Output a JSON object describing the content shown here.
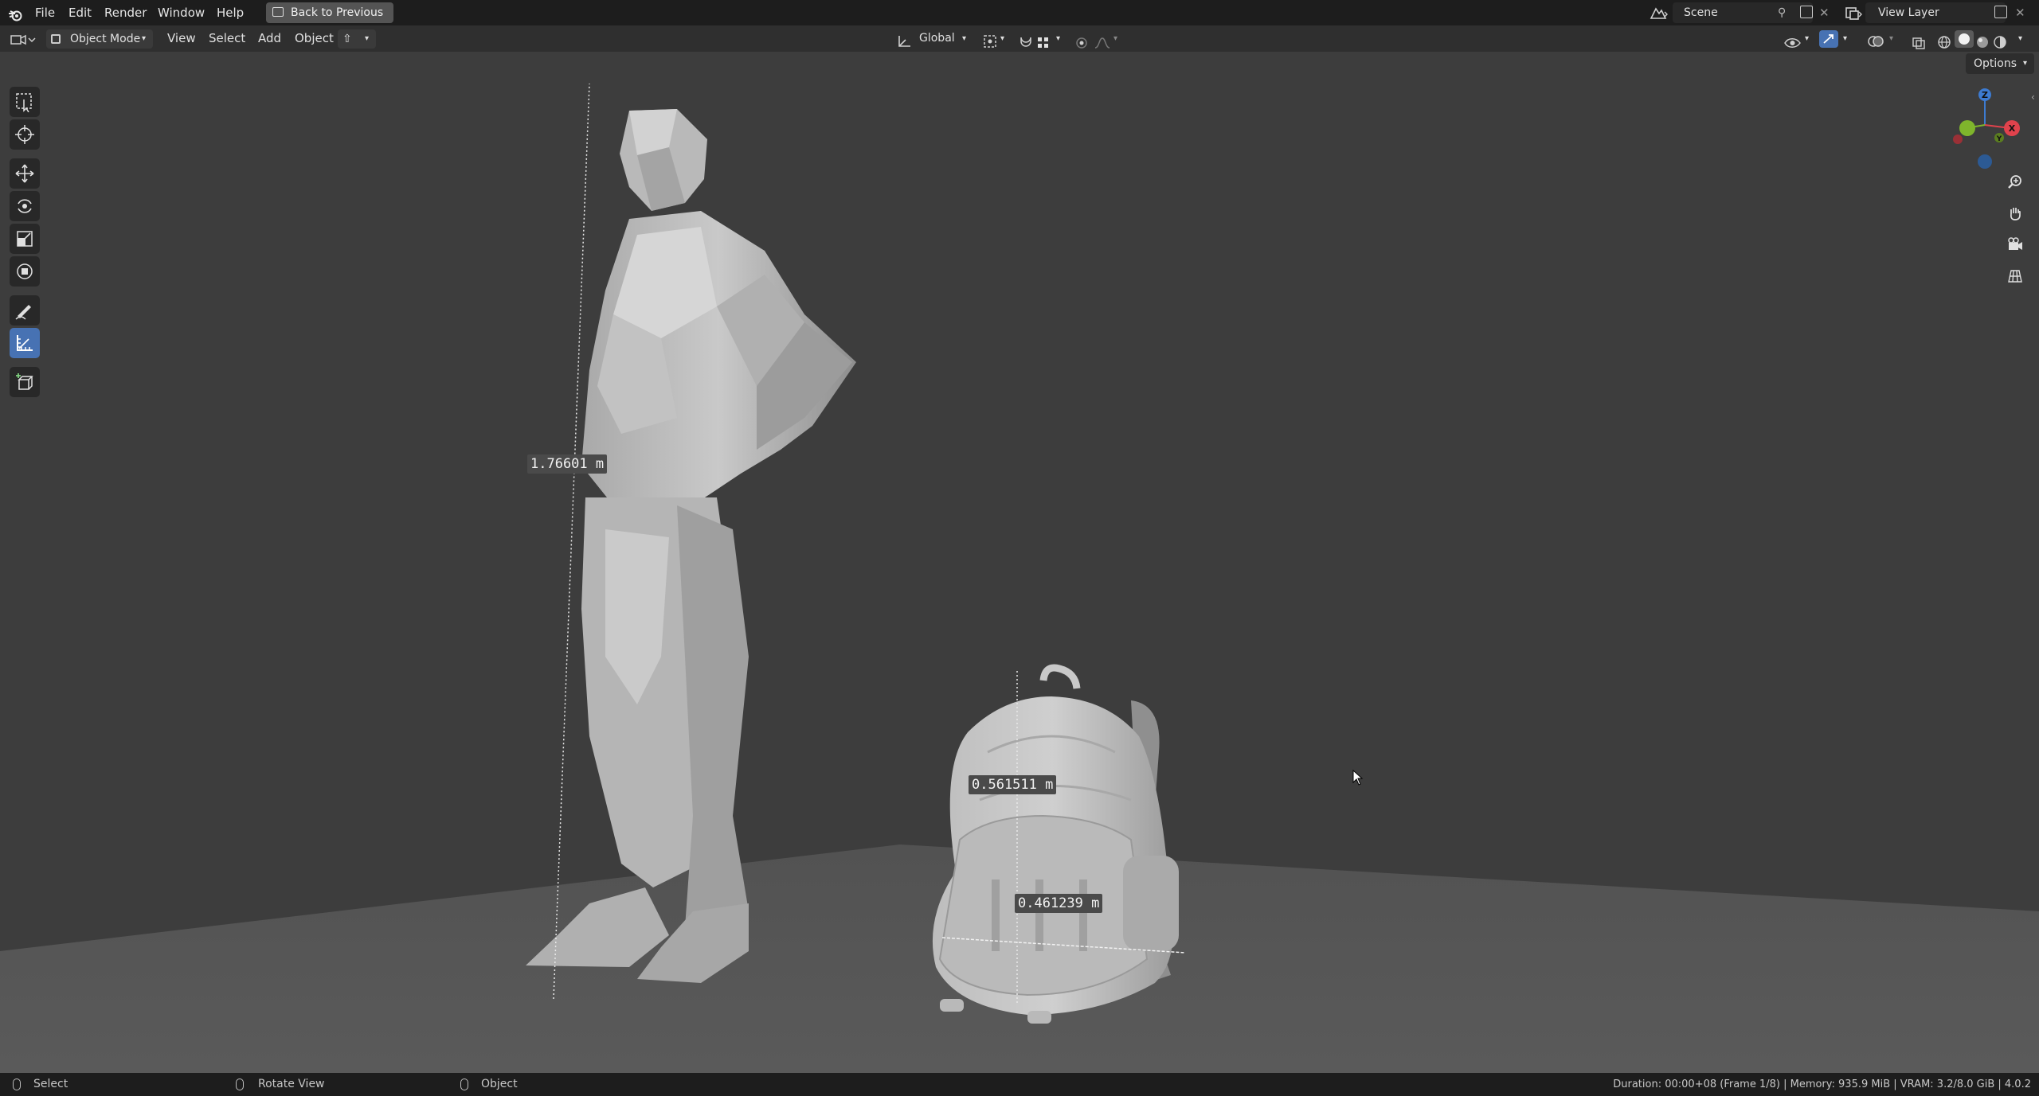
{
  "topbar": {
    "menus": [
      "File",
      "Edit",
      "Render",
      "Window",
      "Help"
    ],
    "back_label": "Back to Previous",
    "scene_label": "Scene",
    "view_layer_label": "View Layer"
  },
  "header": {
    "mode_label": "Object Mode",
    "menus": [
      "View",
      "Select",
      "Add",
      "Object"
    ],
    "orientation_label": "Global",
    "options_label": "Options"
  },
  "viewport": {
    "measurements": {
      "person_height": "1.76601 m",
      "bag_height": "0.561511 m",
      "bag_width": "0.461239 m"
    },
    "gizmo_axes": [
      "Z",
      "Y",
      "X"
    ]
  },
  "statusbar": {
    "left_action": "Select",
    "middle_action": "Rotate View",
    "right_action": "Object",
    "info": "Duration: 00:00+08 (Frame 1/8) | Memory: 935.9 MiB | VRAM: 3.2/8.0 GiB | 4.0.2"
  },
  "colors": {
    "topbar_bg": "#1d1d1d",
    "header_bg": "#2f2f2f",
    "viewport_bg": "#3d3d3d",
    "active_tool": "#4772b3",
    "axis_x": "#e0424c",
    "axis_y": "#7fb52c",
    "axis_z": "#3d7bd1"
  }
}
